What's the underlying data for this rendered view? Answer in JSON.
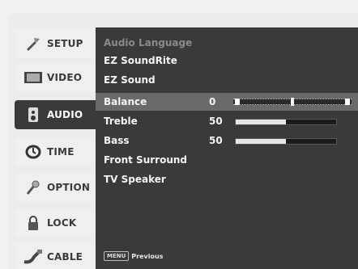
{
  "tabs": [
    {
      "label": "SETUP",
      "icon": "wrench-icon"
    },
    {
      "label": "VIDEO",
      "icon": "screen-icon"
    },
    {
      "label": "AUDIO",
      "icon": "speaker-icon"
    },
    {
      "label": "TIME",
      "icon": "clock-icon"
    },
    {
      "label": "OPTION",
      "icon": "option-icon"
    },
    {
      "label": "LOCK",
      "icon": "lock-icon"
    },
    {
      "label": "CABLE",
      "icon": "cable-icon"
    }
  ],
  "active_tab": "AUDIO",
  "menu": {
    "audio_language": "Audio Language",
    "ez_soundrite": "EZ SoundRite",
    "ez_sound": "EZ Sound",
    "balance": {
      "label": "Balance",
      "value": "0",
      "level": 0.5
    },
    "treble": {
      "label": "Treble",
      "value": "50",
      "level": 0.5
    },
    "bass": {
      "label": "Bass",
      "value": "50",
      "level": 0.5
    },
    "front_surround": "Front Surround",
    "tv_speaker": "TV Speaker"
  },
  "footer": {
    "key": "MENU",
    "label": "Previous"
  },
  "colors": {
    "panel": "#3a3a3a",
    "selected_row": "#6a6a6a",
    "tab_bg": "#efefef"
  }
}
